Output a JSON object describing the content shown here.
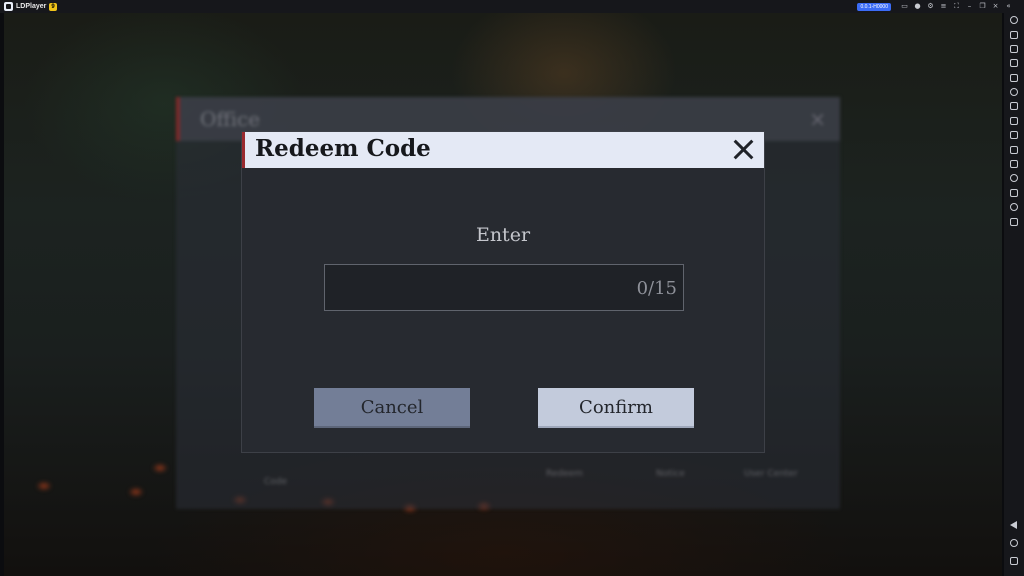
{
  "window": {
    "app_name": "LDPlayer",
    "version_badge": "9",
    "title_badge": "0.0.1-H0000"
  },
  "game": {
    "office": {
      "title": "Office",
      "close_glyph": "×",
      "labels": [
        "Code",
        "Redeem",
        "Notice",
        "User Center"
      ]
    },
    "dialog": {
      "title": "Redeem Code",
      "enter_label": "Enter",
      "input_value": "",
      "input_counter": "0/15",
      "cancel_label": "Cancel",
      "confirm_label": "Confirm"
    }
  },
  "sidebar_icons": [
    "settings-icon",
    "keyboard-icon",
    "volume-up-icon",
    "volume-down-icon",
    "screenshot-icon",
    "rotate-icon",
    "record-icon",
    "fps-icon",
    "scissors-icon",
    "sync-icon",
    "apk-icon",
    "shake-icon",
    "folder-icon",
    "location-icon",
    "vibrate-icon",
    "back-icon",
    "home-icon",
    "recent-apps-icon"
  ],
  "colors": {
    "dialog_header": "#e4e9f5",
    "dialog_accent": "#9a2a2f",
    "cancel_button": "#737e97",
    "confirm_button": "#c3cbdc"
  }
}
